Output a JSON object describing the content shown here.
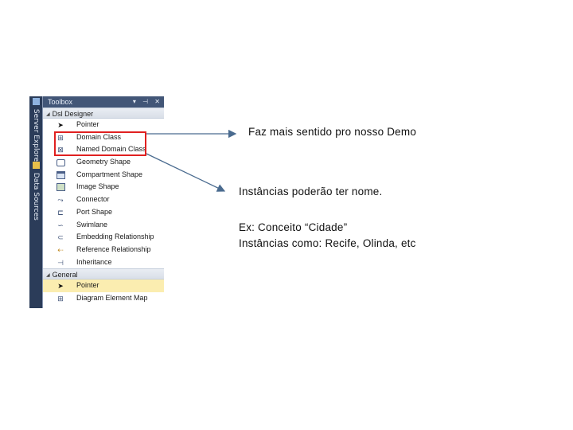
{
  "side_strip": {
    "tabs": [
      {
        "label": "Server Explorer",
        "icon": "server-icon"
      },
      {
        "label": "Data Sources",
        "icon": "database-icon"
      }
    ]
  },
  "toolbox": {
    "title": "Toolbox",
    "title_buttons": "▾ ⊣ ✕",
    "groups": [
      {
        "label": "Dsl Designer",
        "items": [
          {
            "label": "Pointer",
            "icon": "pointer-icon"
          },
          {
            "label": "Domain Class",
            "icon": "domain-class-icon"
          },
          {
            "label": "Named Domain Class",
            "icon": "named-domain-class-icon"
          },
          {
            "label": "Geometry Shape",
            "icon": "geometry-shape-icon"
          },
          {
            "label": "Compartment Shape",
            "icon": "compartment-shape-icon"
          },
          {
            "label": "Image Shape",
            "icon": "image-shape-icon"
          },
          {
            "label": "Connector",
            "icon": "connector-icon"
          },
          {
            "label": "Port Shape",
            "icon": "port-shape-icon"
          },
          {
            "label": "Swimlane",
            "icon": "swimlane-icon"
          },
          {
            "label": "Embedding Relationship",
            "icon": "embedding-relationship-icon"
          },
          {
            "label": "Reference Relationship",
            "icon": "reference-relationship-icon"
          },
          {
            "label": "Inheritance",
            "icon": "inheritance-icon"
          }
        ]
      },
      {
        "label": "General",
        "items": [
          {
            "label": "Pointer",
            "icon": "pointer-icon",
            "selected": true
          },
          {
            "label": "Diagram Element Map",
            "icon": "diagram-element-map-icon"
          }
        ]
      }
    ]
  },
  "annotations": {
    "first": "Faz mais sentido pro nosso Demo",
    "second": "Instâncias poderão ter nome.",
    "example_line1": "Ex: Conceito “Cidade”",
    "example_line2": "Instâncias como: Recife, Olinda, etc"
  },
  "colors": {
    "highlight": "#e02020",
    "arrow": "#4a6b8f",
    "toolbox_title": "#425677",
    "selected_item": "#fbedb0"
  }
}
